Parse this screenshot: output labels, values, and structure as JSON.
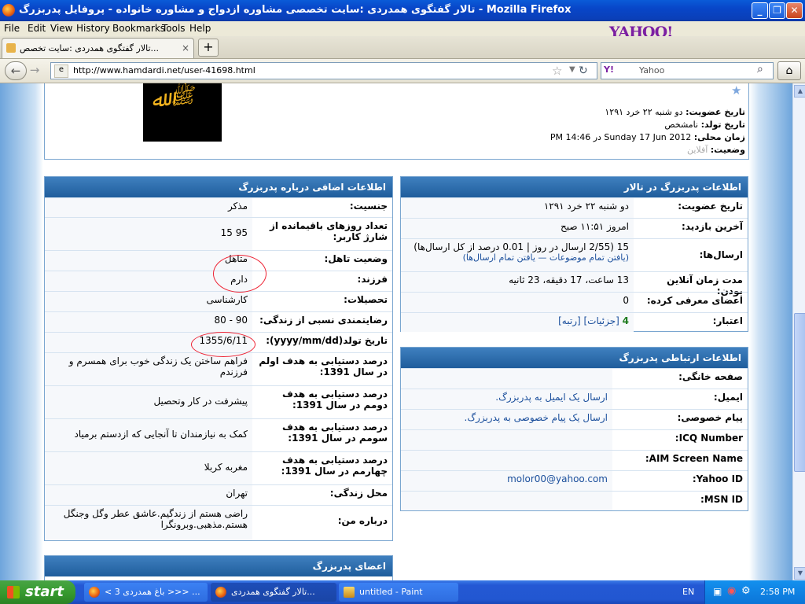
{
  "window": {
    "title": "تالار گفتگوی همدردی :سایت تخصصی مشاوره ازدواج و مشاوره خانواده - پروفایل پدربزرگ - Mozilla Firefox"
  },
  "menu": [
    "File",
    "Edit",
    "View",
    "History",
    "Bookmarks",
    "Tools",
    "Help"
  ],
  "brand": "YAHOO!",
  "tab": {
    "label": "تالار گفتگوی همدردی :سایت تخصص...",
    "close": "×"
  },
  "newtab": "+",
  "address": {
    "url": "http://www.hamdardi.net/user-41698.html"
  },
  "search": {
    "engine": "Y!",
    "placeholder": "Yahoo"
  },
  "top": {
    "lines": [
      {
        "label": "تاریخ عضویت:",
        "value": "دو شنبه ۲۲ خرد ۱۲۹۱"
      },
      {
        "label": "تاریخ تولد:",
        "value": "نامشخص"
      },
      {
        "label": "زمان محلی:",
        "value": "Sunday 17 Jun 2012 در 14:46 PM"
      },
      {
        "label": "وضعیت:",
        "value": "آفلاین"
      }
    ]
  },
  "extra": {
    "title": "اطلاعات اضافی درباره پدربزرگ",
    "rows": [
      {
        "label": "جنسیت:",
        "value": "مذکر"
      },
      {
        "label": "تعداد روزهای باقیمانده از شارژ کاربر:",
        "value": "95 15"
      },
      {
        "label": "وضعیت تاهل:",
        "value": "متاهل"
      },
      {
        "label": "فرزند:",
        "value": "دارم"
      },
      {
        "label": "تحصیلات:",
        "value": "کارشناسی"
      },
      {
        "label": "رضایتمندی نسبی از زندگی:",
        "value": "90 - 80"
      },
      {
        "label": "تاریخ تولد(yyyy/mm/dd):",
        "value": "1355/6/11"
      },
      {
        "label": "درصد دستیابی به هدف اولم در سال 1391:",
        "value": "فراهم ساختن یک زندگی خوب برای همسرم و فرزندم"
      },
      {
        "label": "درصد دستیابی به هدف دومم در سال 1391:",
        "value": "پیشرفت در کار وتحصیل"
      },
      {
        "label": "درصد دستیابی به هدف سومم در سال 1391:",
        "value": "کمک به نیازمندان تا آنجایی که ازدستم برمیاد"
      },
      {
        "label": "درصد دستیابی به هدف چهارمم در سال 1391:",
        "value": "مغربه کربلا"
      },
      {
        "label": "محل زندگی:",
        "value": "تهران"
      },
      {
        "label": "درباره من:",
        "value": "راضی هستم از زندگیم.عاشق عطر وگل وجنگل هستم.مذهبی.وبرونگرا"
      }
    ]
  },
  "forum": {
    "title": "اطلاعات پدربزرگ در تالار",
    "rows": [
      {
        "label": "تاریخ عضویت:",
        "value": "دو شنبه ۲۲ خرد ۱۲۹۱"
      },
      {
        "label": "آخرین بازدید:",
        "value": "امروز ۱۱:۵۱ صبح"
      },
      {
        "label": "ارسال‌ها:",
        "value": "15 (2/55 ارسال در روز | 0.01 درصد از کل ارسال‌ها)",
        "value2": "(یافتن تمام موضوعات — یافتن تمام ارسال‌ها)"
      },
      {
        "label": "مدت زمان آنلاین بودن:",
        "value": "13 ساعت، 17 دقیقه، 23 ثانیه"
      },
      {
        "label": "اعضای معرفی کرده:",
        "value": "0"
      },
      {
        "label": "اعتبار:",
        "value": "4",
        "value_links": "[جزئیات] [رتبه]"
      }
    ]
  },
  "contact": {
    "title": "اطلاعات ارتباطی پدربزرگ",
    "rows": [
      {
        "label": "صفحه خانگی:",
        "value": ""
      },
      {
        "label": "ایمیل:",
        "value": "ارسال یک ایمیل به پدربزرگ."
      },
      {
        "label": "پیام خصوصی:",
        "value": "ارسال یک پیام خصوصی به پدربزرگ."
      },
      {
        "label": "ICQ Number:",
        "value": ""
      },
      {
        "label": "AIM Screen Name:",
        "value": ""
      },
      {
        "label": "Yahoo ID:",
        "value": "molor00@yahoo.com"
      },
      {
        "label": "MSN ID:",
        "value": ""
      }
    ]
  },
  "members": {
    "title": "اعضای پدربزرگ"
  },
  "taskbar": {
    "start": "start",
    "tasks": [
      "< باغ همدردی 3 >>> ...",
      "تالار گفتگوی همدردی...",
      "untitled - Paint"
    ],
    "lang": "EN",
    "clock": "2:58 PM"
  }
}
